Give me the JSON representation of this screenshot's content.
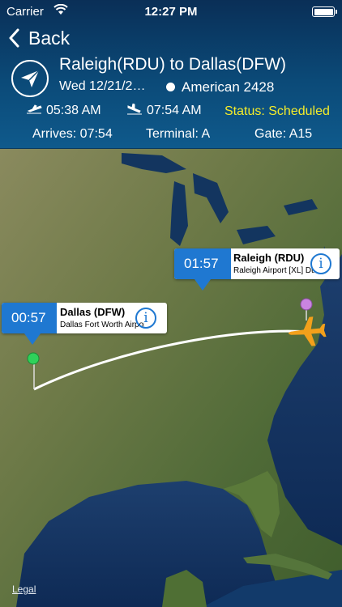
{
  "status_bar": {
    "carrier": "Carrier",
    "time": "12:27 PM"
  },
  "nav": {
    "back_label": "Back"
  },
  "flight": {
    "route": "Raleigh(RDU) to Dallas(DFW)",
    "date": "Wed 12/21/2…",
    "airline": "American 2428",
    "departure_time": "05:38 AM",
    "arrival_time": "07:54 AM",
    "status": "Status: Scheduled",
    "arrives": "Arrives: 07:54",
    "terminal": "Terminal: A",
    "gate": "Gate: A15"
  },
  "map": {
    "origin": {
      "duration": "01:57",
      "name": "Raleigh (RDU)",
      "airport": "Raleigh Airport [XL] Durh…"
    },
    "destination": {
      "duration": "00:57",
      "name": "Dallas (DFW)",
      "airport": "Dallas Fort Worth Airport"
    },
    "legal_label": "Legal"
  },
  "colors": {
    "status": "#f4ec2b",
    "accent": "#1f78d1",
    "plane": "#f3a01b"
  }
}
